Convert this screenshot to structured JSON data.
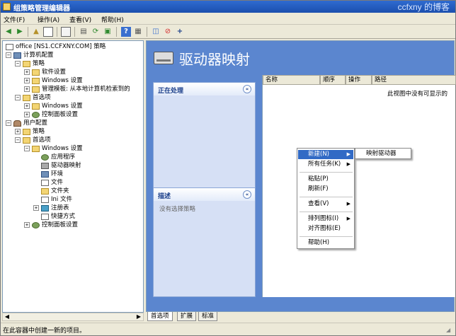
{
  "window": {
    "title": "组策略管理编辑器",
    "watermark": "ccfxny 的博客"
  },
  "menu": [
    {
      "label": "文件(F)",
      "key": "file"
    },
    {
      "label": "操作(A)",
      "key": "action"
    },
    {
      "label": "查看(V)",
      "key": "view"
    },
    {
      "label": "帮助(H)",
      "key": "help"
    }
  ],
  "toolbar": {
    "icons": [
      "back-arrow-icon",
      "forward-arrow-icon",
      "up-folder-icon",
      "show-hide-tree-icon",
      "copy-icon",
      "export-list-icon",
      "refresh-icon",
      "properties-icon",
      "help-icon",
      "console-icon",
      "filter-icon",
      "delete-icon",
      "add-icon"
    ]
  },
  "tree": {
    "root": "office [NS1.CCFXNY.COM] 策略",
    "nodes": [
      {
        "label": "计算机配置"
      },
      {
        "label": "策略"
      },
      {
        "label": "软件设置"
      },
      {
        "label": "Windows 设置"
      },
      {
        "label": "管理模板: 从本地计算机检索到的"
      },
      {
        "label": "首选项"
      },
      {
        "label": "Windows 设置"
      },
      {
        "label": "控制面板设置"
      },
      {
        "label": "用户配置"
      },
      {
        "label": "策略"
      },
      {
        "label": "首选项"
      },
      {
        "label": "Windows 设置"
      },
      {
        "label": "应用程序"
      },
      {
        "label": "驱动器映射"
      },
      {
        "label": "环境"
      },
      {
        "label": "文件"
      },
      {
        "label": "文件夹"
      },
      {
        "label": "Ini 文件"
      },
      {
        "label": "注册表"
      },
      {
        "label": "快捷方式"
      },
      {
        "label": "控制面板设置"
      }
    ],
    "expander_plus": "+",
    "expander_minus": "−"
  },
  "main": {
    "heading": "驱动器映射",
    "processing_panel": {
      "title": "正在处理",
      "collapse": "«"
    },
    "description_panel": {
      "title": "描述",
      "text": "没有选择策略",
      "collapse": "«"
    },
    "columns": [
      "名称",
      "顺序",
      "操作",
      "路径"
    ],
    "empty_text": "此视图中没有可显示的"
  },
  "context_menu": {
    "items": [
      {
        "label": "新建(N)",
        "has_submenu": true,
        "highlighted": true
      },
      {
        "label": "所有任务(K)",
        "has_submenu": true
      },
      {
        "label": "粘贴(P)"
      },
      {
        "label": "刷新(F)"
      },
      {
        "label": "查看(V)",
        "has_submenu": true
      },
      {
        "label": "排列图标(I)",
        "has_submenu": true
      },
      {
        "label": "对齐图标(E)"
      },
      {
        "label": "帮助(H)"
      }
    ],
    "submenu_arrow": "▶",
    "submenu": [
      {
        "label": "映射驱动器"
      }
    ]
  },
  "tabs": [
    {
      "label": "首选项",
      "active": true
    },
    {
      "label": "扩展",
      "active": false
    },
    {
      "label": "标准",
      "active": false
    }
  ],
  "statusbar": {
    "text": "在此容器中创建一新的项目。"
  }
}
